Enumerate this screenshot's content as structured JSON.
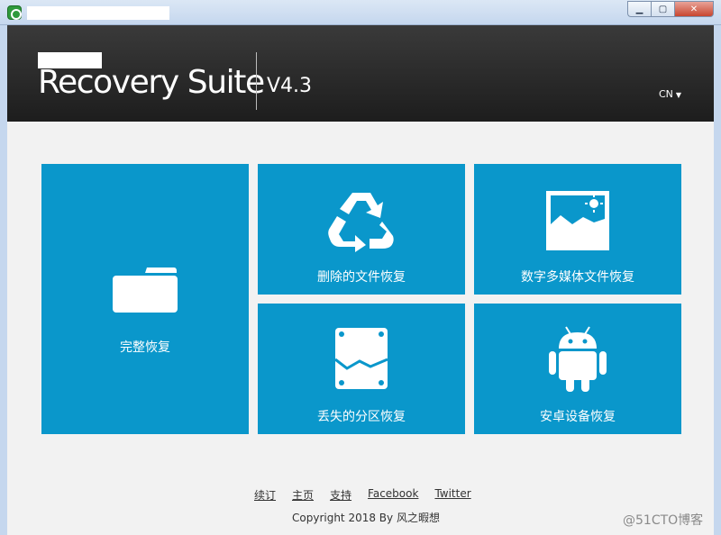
{
  "header": {
    "brand": "Recovery Suite",
    "version": "V4.3",
    "language": "CN"
  },
  "tiles": {
    "full": {
      "label": "完整恢复",
      "icon": "folder-icon"
    },
    "deleted": {
      "label": "删除的文件恢复",
      "icon": "recycle-icon"
    },
    "media": {
      "label": "数字多媒体文件恢复",
      "icon": "picture-icon"
    },
    "partition": {
      "label": "丢失的分区恢复",
      "icon": "disk-icon"
    },
    "android": {
      "label": "安卓设备恢复",
      "icon": "android-icon"
    }
  },
  "footer": {
    "links": [
      "续订",
      "主页",
      "支持",
      "Facebook",
      "Twitter"
    ],
    "copyright": "Copyright 2018 By 风之暇想",
    "watermark": "@51CTO博客"
  },
  "colors": {
    "tile": "#0a97cb",
    "header": "#222222",
    "content_bg": "#f2f2f2"
  }
}
